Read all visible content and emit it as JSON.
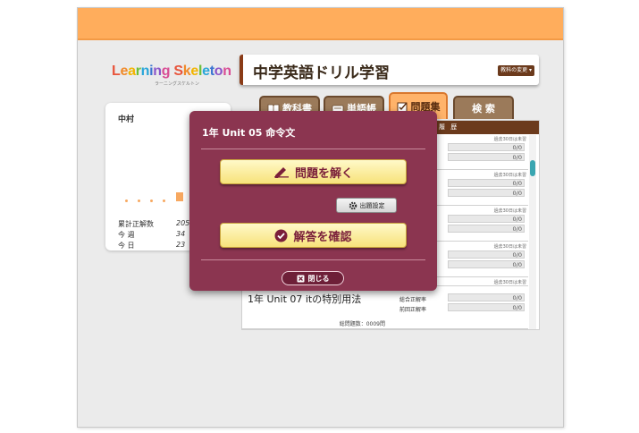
{
  "header": {
    "logo_text": "Learning Skeleton",
    "logo_sub": "ラーニングスケルトン",
    "app_title": "中学英語ドリル学習",
    "change_subject_label": "教科の変更"
  },
  "tabs": [
    {
      "label": "教科書",
      "icon": "book-icon"
    },
    {
      "label": "単語帳",
      "icon": "wordbook-icon"
    },
    {
      "label": "問題集",
      "icon": "checklist-icon"
    },
    {
      "label": "検 索",
      "icon": ""
    }
  ],
  "user": {
    "name": "中村",
    "stats": [
      {
        "label": "累計正解数",
        "value": "205"
      },
      {
        "label": "今 週",
        "value": "34"
      },
      {
        "label": "今 日",
        "value": "23"
      }
    ]
  },
  "list": {
    "history_header": "履 歴",
    "past_label": "過去30日は未習",
    "rate_labels": [
      "総合正解率",
      "前回正解率"
    ],
    "zero_value": "0/0",
    "visible_entry": {
      "title": "1年 Unit 07 itの特別用法",
      "question_count": "総問題数：0009問"
    }
  },
  "modal": {
    "title": "1年 Unit 05 命令文",
    "solve_label": "問題を解く",
    "settings_label": "出題設定",
    "answers_label": "解答を確認",
    "close_label": "閉じる"
  },
  "colors": {
    "topbar": "#ffad5c",
    "modal_bg": "#8b3550",
    "button_yellow": "#f7e27a",
    "header_brown": "#6b3a1c",
    "scroll_teal": "#3aa6b1"
  }
}
